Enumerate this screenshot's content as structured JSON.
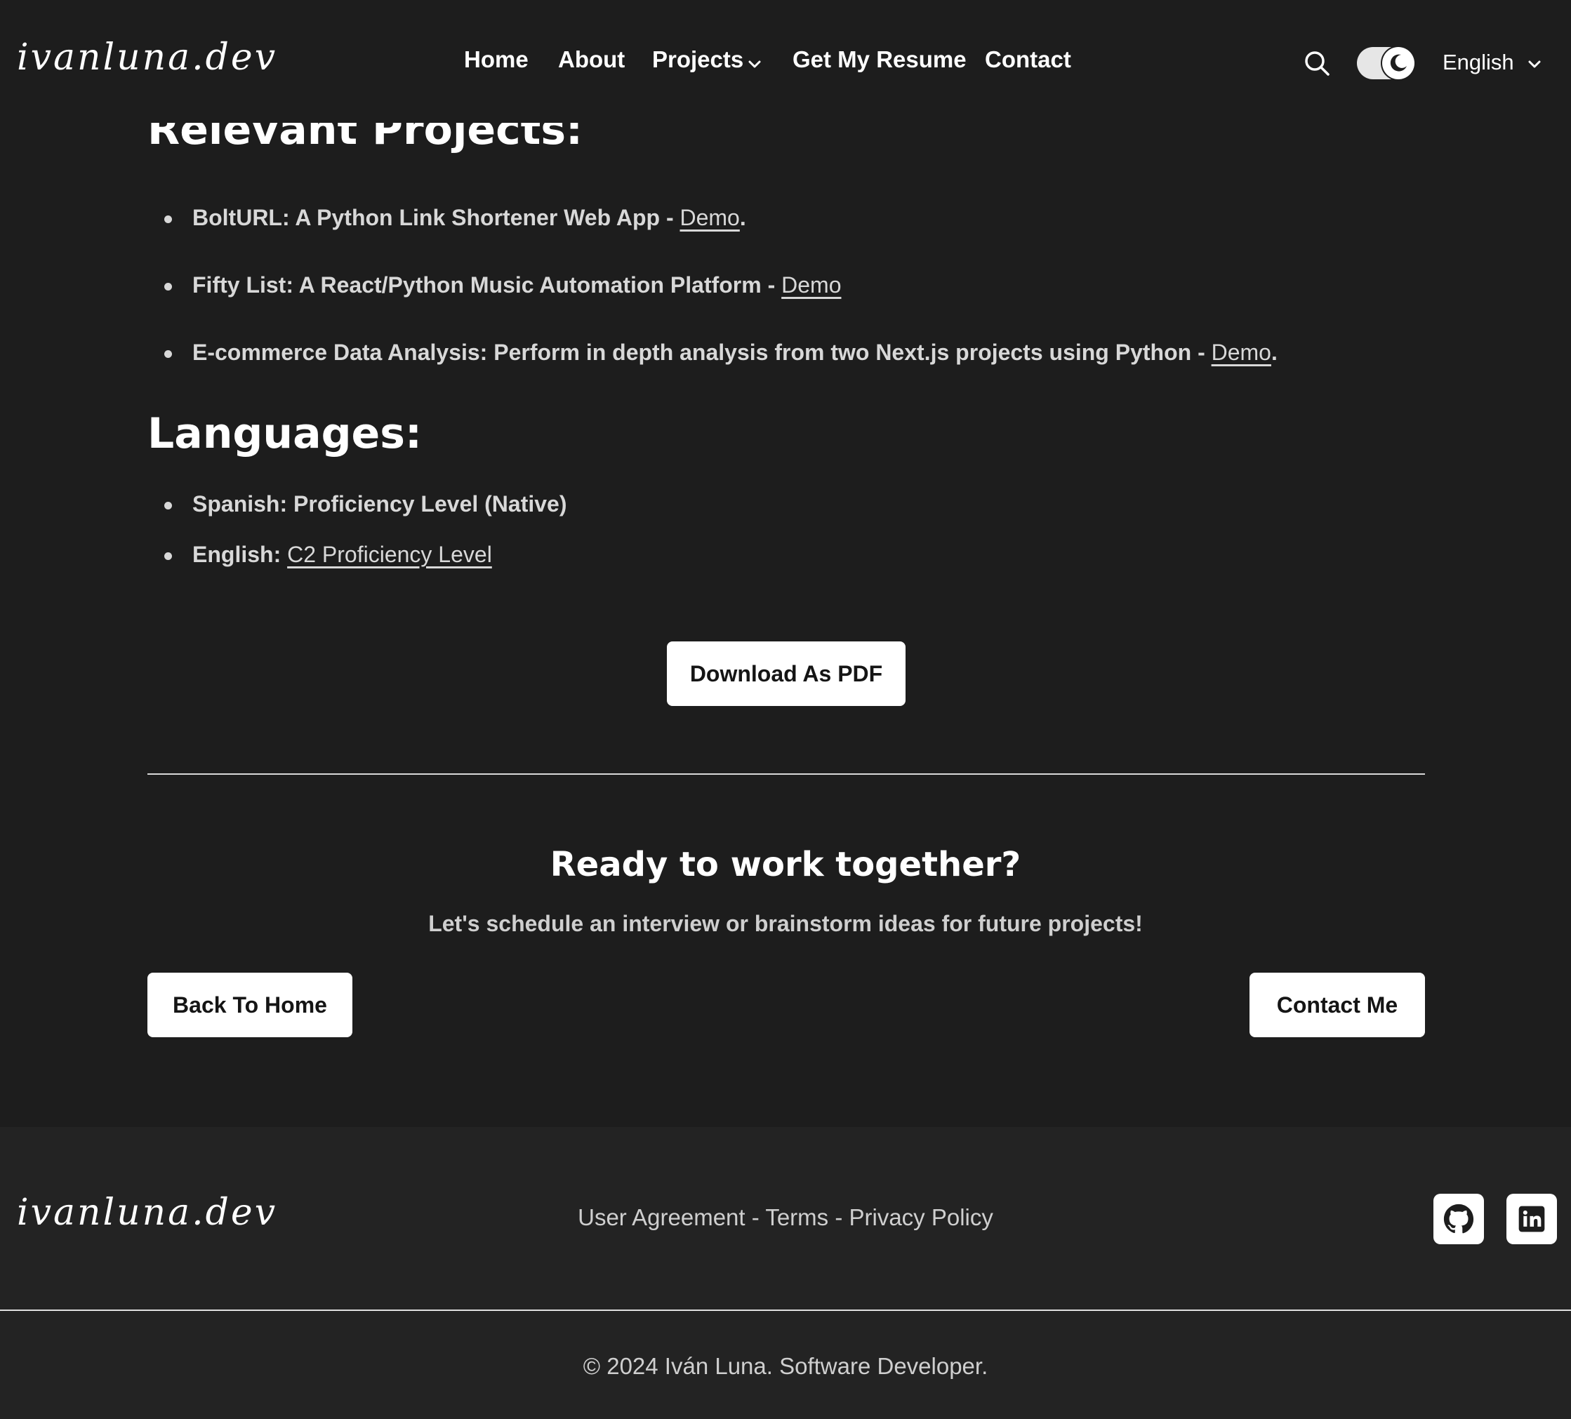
{
  "header": {
    "logo_text": "ivanluna.dev",
    "nav": {
      "home": "Home",
      "about": "About",
      "projects": "Projects",
      "resume": "Get My Resume",
      "contact": "Contact"
    },
    "language": "English",
    "theme_toggle": "dark"
  },
  "main": {
    "projects_heading": "Relevant Projects:",
    "projects": [
      {
        "text": "BoltURL: A Python Link Shortener Web App - ",
        "link": "Demo",
        "suffix": "."
      },
      {
        "text": "Fifty List: A React/Python Music Automation Platform - ",
        "link": "Demo",
        "suffix": ""
      },
      {
        "text": "E-commerce Data Analysis: Perform in depth analysis from two Next.js projects using Python - ",
        "link": "Demo",
        "suffix": "."
      }
    ],
    "languages_heading": "Languages:",
    "languages": [
      {
        "text": "Spanish: Proficiency Level (Native)",
        "link": ""
      },
      {
        "text": "English: ",
        "link": "C2 Proficiency Level"
      }
    ],
    "download_button": "Download As PDF"
  },
  "cta": {
    "title": "Ready to work together?",
    "subtitle": "Let's schedule an interview or brainstorm ideas for future projects!",
    "back_button": "Back To Home",
    "contact_button": "Contact Me"
  },
  "footer": {
    "logo_text": "ivanluna.dev",
    "links": [
      "User Agreement",
      "Terms",
      "Privacy Policy"
    ],
    "separator": " - ",
    "social": [
      "github-icon",
      "linkedin-icon"
    ],
    "copyright": "© 2024 Iván Luna. Software Developer."
  },
  "colors": {
    "background": "#1d1d1d",
    "footer_background": "#232323",
    "text": "#ffffff",
    "muted_text": "#d8d8d8",
    "button_background": "#ffffff"
  }
}
